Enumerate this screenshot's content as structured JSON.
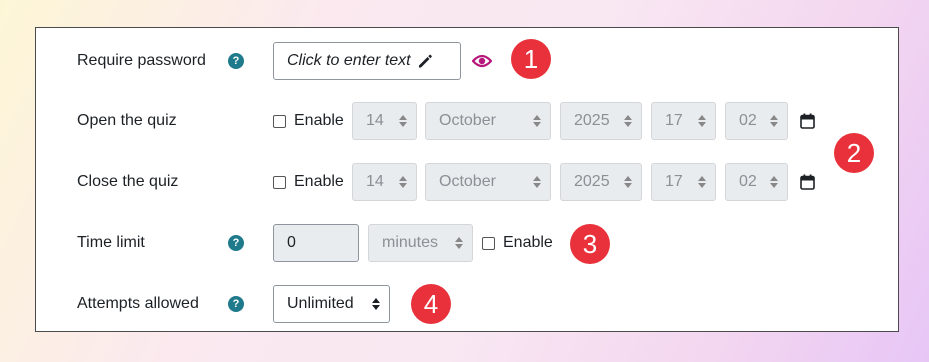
{
  "form": {
    "require_password": {
      "label": "Require password",
      "help": "?",
      "placeholder": "Click to enter text"
    },
    "open_quiz": {
      "label": "Open the quiz",
      "enable_label": "Enable",
      "day": "14",
      "month": "October",
      "year": "2025",
      "hour": "17",
      "minute": "02"
    },
    "close_quiz": {
      "label": "Close the quiz",
      "enable_label": "Enable",
      "day": "14",
      "month": "October",
      "year": "2025",
      "hour": "17",
      "minute": "02"
    },
    "time_limit": {
      "label": "Time limit",
      "help": "?",
      "value": "0",
      "unit": "minutes",
      "enable_label": "Enable"
    },
    "attempts": {
      "label": "Attempts allowed",
      "help": "?",
      "value": "Unlimited"
    }
  },
  "badges": [
    "1",
    "2",
    "3",
    "4"
  ],
  "colors": {
    "badge": "#e8313b",
    "help_icon": "#1f7a8c",
    "eye_icon": "#b5177a",
    "calendar_icon": "#1d2125"
  }
}
